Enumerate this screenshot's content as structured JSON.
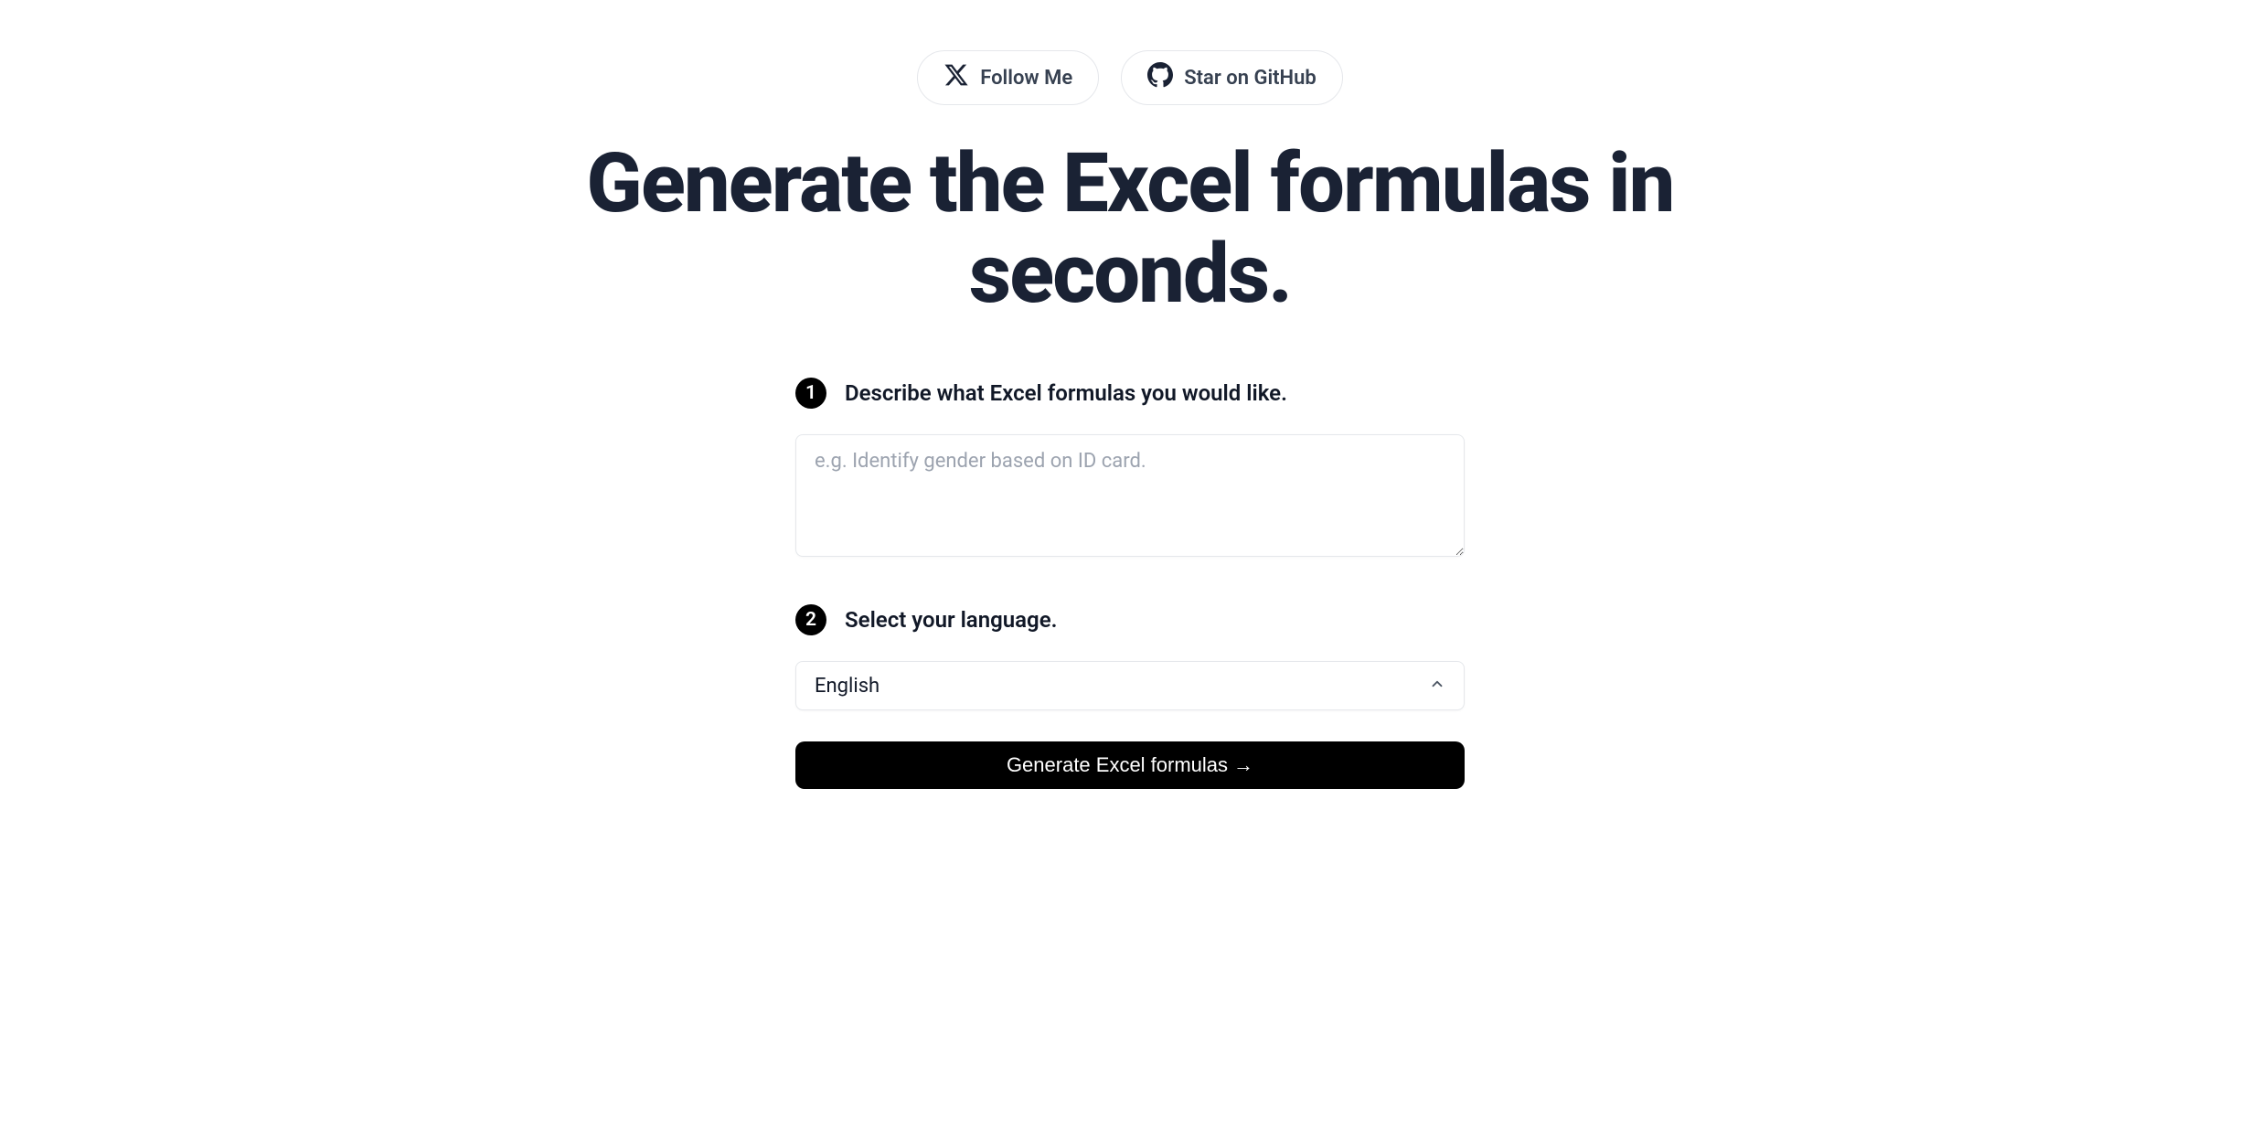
{
  "links": {
    "follow": "Follow Me",
    "github": "Star on GitHub"
  },
  "hero": {
    "title": "Generate the Excel formulas in seconds."
  },
  "steps": {
    "one": {
      "number": "1",
      "label": "Describe what Excel formulas you would like."
    },
    "two": {
      "number": "2",
      "label": "Select your language."
    }
  },
  "textarea": {
    "placeholder": "e.g. Identify gender based on ID card.",
    "value": ""
  },
  "language": {
    "selected": "English"
  },
  "button": {
    "label": "Generate Excel formulas",
    "arrow": "→"
  }
}
